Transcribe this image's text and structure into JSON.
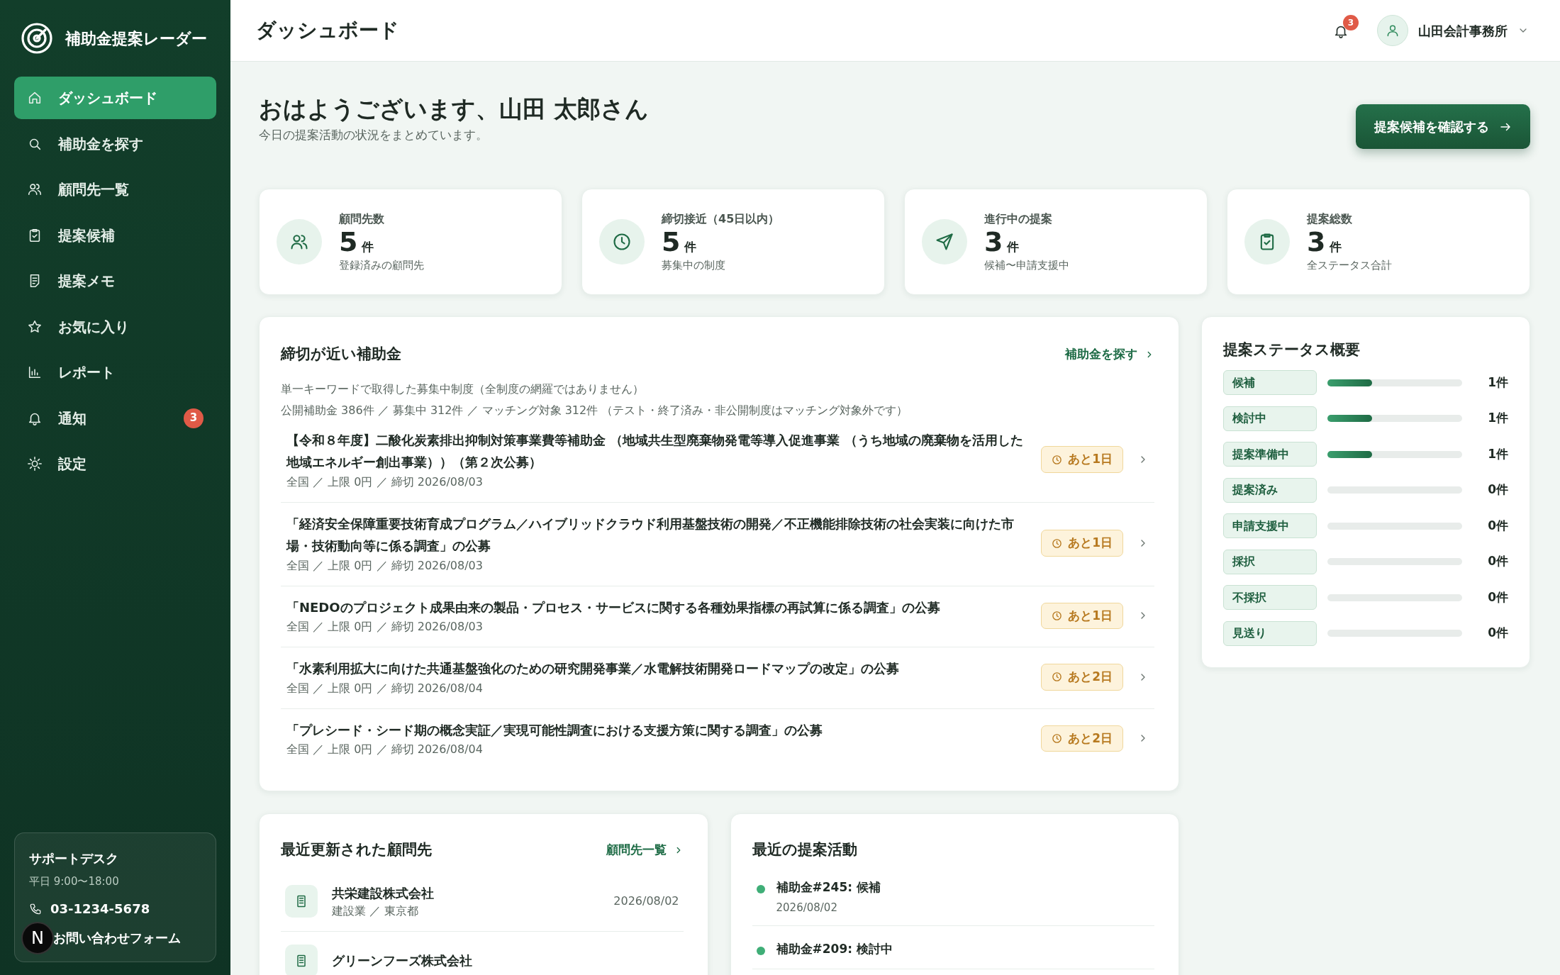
{
  "sidebar": {
    "brand": "補助金提案レーダー",
    "items": [
      {
        "label": "ダッシュボード",
        "selected": true
      },
      {
        "label": "補助金を探す",
        "selected": false
      },
      {
        "label": "顧問先一覧",
        "selected": false
      },
      {
        "label": "提案候補",
        "selected": false
      },
      {
        "label": "提案メモ",
        "selected": false
      },
      {
        "label": "お気に入り",
        "selected": false
      },
      {
        "label": "レポート",
        "selected": false
      },
      {
        "label": "通知",
        "selected": false,
        "badge": "3"
      },
      {
        "label": "設定",
        "selected": false
      }
    ],
    "support": {
      "title": "サポートデスク",
      "hours": "平日 9:00〜18:00",
      "phone": "03-1234-5678",
      "form_link": "お問い合わせフォーム"
    }
  },
  "dev_indicator": {
    "label": "N"
  },
  "header": {
    "title": "ダッシュボード",
    "notification_count": "3",
    "user": "山田会計事務所"
  },
  "greeting": {
    "title": "おはようございます、山田 太郎さん",
    "subtitle": "今日の提案活動の状況をまとめています。",
    "action": "提案候補を確認する"
  },
  "stats": [
    {
      "label": "顧問先数",
      "value": "5",
      "unit": "件",
      "note": "登録済みの顧問先"
    },
    {
      "label": "締切接近（45日以内）",
      "value": "5",
      "unit": "件",
      "note": "募集中の制度"
    },
    {
      "label": "進行中の提案",
      "value": "3",
      "unit": "件",
      "note": "候補〜申請支援中"
    },
    {
      "label": "提案総数",
      "value": "3",
      "unit": "件",
      "note": "全ステータス合計"
    }
  ],
  "deadlines": {
    "title": "締切が近い補助金",
    "link": "補助金を探す",
    "notes": [
      "単一キーワードで取得した募集中制度（全制度の網羅ではありません）",
      "公開補助金 386件 ／ 募集中 312件 ／ マッチング対象 312件 （テスト・終了済み・非公開制度はマッチング対象外です）"
    ],
    "items": [
      {
        "title": "【令和８年度】二酸化炭素排出抑制対策事業費等補助金 （地域共生型廃棄物発電等導入促進事業 （うち地域の廃棄物を活用した地域エネルギー創出事業））（第２次公募）",
        "meta": "全国 ／ 上限 0円 ／ 締切 2026/08/03",
        "badge": "あと1日"
      },
      {
        "title": "「経済安全保障重要技術育成プログラム／ハイブリッドクラウド利用基盤技術の開発／不正機能排除技術の社会実装に向けた市場・技術動向等に係る調査」の公募",
        "meta": "全国 ／ 上限 0円 ／ 締切 2026/08/03",
        "badge": "あと1日"
      },
      {
        "title": "「NEDOのプロジェクト成果由来の製品・プロセス・サービスに関する各種効果指標の再試算に係る調査」の公募",
        "meta": "全国 ／ 上限 0円 ／ 締切 2026/08/03",
        "badge": "あと1日"
      },
      {
        "title": "「水素利用拡大に向けた共通基盤強化のための研究開発事業／水電解技術開発ロードマップの改定」の公募",
        "meta": "全国 ／ 上限 0円 ／ 締切 2026/08/04",
        "badge": "あと2日"
      },
      {
        "title": "「プレシード・シード期の概念実証／実現可能性調査における支援方策に関する調査」の公募",
        "meta": "全国 ／ 上限 0円 ／ 締切 2026/08/04",
        "badge": "あと2日"
      }
    ]
  },
  "status_overview": {
    "title": "提案ステータス概要",
    "rows": [
      {
        "label": "候補",
        "level": 0.33,
        "count": "1件"
      },
      {
        "label": "検討中",
        "level": 0.33,
        "count": "1件"
      },
      {
        "label": "提案準備中",
        "level": 0.33,
        "count": "1件"
      },
      {
        "label": "提案済み",
        "level": 0,
        "count": "0件"
      },
      {
        "label": "申請支援中",
        "level": 0,
        "count": "0件"
      },
      {
        "label": "採択",
        "level": 0,
        "count": "0件"
      },
      {
        "label": "不採択",
        "level": 0,
        "count": "0件"
      },
      {
        "label": "見送り",
        "level": 0,
        "count": "0件"
      }
    ]
  },
  "recent_clients": {
    "title": "最近更新された顧問先",
    "link": "顧問先一覧",
    "items": [
      {
        "name": "共栄建設株式会社",
        "meta": "建設業 ／ 東京都",
        "date": "2026/08/02"
      },
      {
        "name": "グリーンフーズ株式会社"
      }
    ]
  },
  "recent_activity": {
    "title": "最近の提案活動",
    "items": [
      {
        "label": "補助金#245: 候補",
        "date": "2026/08/02"
      },
      {
        "label": "補助金#209: 検討中"
      }
    ]
  }
}
